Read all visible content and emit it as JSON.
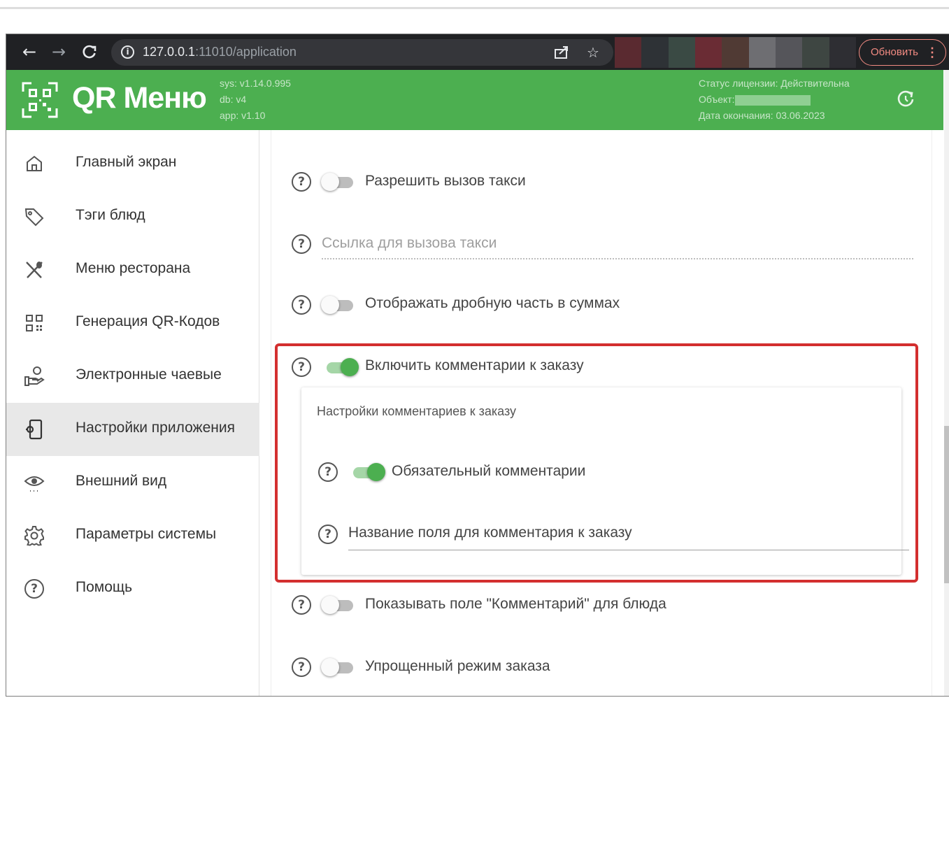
{
  "browser": {
    "url_host": "127.0.0.1",
    "url_rest": ":11010/application",
    "update_label": "Обновить",
    "menu_dots": "⋮"
  },
  "header": {
    "title": "QR Меню",
    "sys_version": "sys: v1.14.0.995",
    "db_version": "db: v4",
    "app_version": "app: v1.10",
    "license_status": "Статус лицензии: Действительна",
    "object_label": "Объект:",
    "expiry": "Дата окончания: 03.06.2023"
  },
  "sidebar": {
    "items": [
      {
        "label": "Главный экран",
        "icon": "home-icon"
      },
      {
        "label": "Тэги блюд",
        "icon": "tag-icon"
      },
      {
        "label": "Меню ресторана",
        "icon": "utensils-icon"
      },
      {
        "label": "Генерация QR-Кодов",
        "icon": "qr-code-icon"
      },
      {
        "label": "Электронные чаевые",
        "icon": "tip-hand-icon"
      },
      {
        "label": "Настройки приложения",
        "icon": "app-settings-icon",
        "active": true
      },
      {
        "label": "Внешний вид",
        "icon": "eye-icon"
      },
      {
        "label": "Параметры системы",
        "icon": "gear-icon"
      },
      {
        "label": "Помощь",
        "icon": "help-icon"
      }
    ]
  },
  "settings": {
    "taxi_toggle": {
      "label": "Разрешить вызов такси",
      "on": false
    },
    "taxi_link": {
      "placeholder": "Ссылка для вызова такси"
    },
    "fraction_toggle": {
      "label": "Отображать дробную часть в суммах",
      "on": false
    },
    "comments_toggle": {
      "label": "Включить комментарии к заказу",
      "on": true
    },
    "comments_section": {
      "title": "Настройки комментариев к заказу",
      "required_toggle": {
        "label": "Обязательный комментарии",
        "on": true
      },
      "field_name": {
        "placeholder": "Название поля для комментария к заказу"
      }
    },
    "dish_comment_toggle": {
      "label": "Показывать поле \"Комментарий\" для блюда",
      "on": false
    },
    "simple_mode_toggle": {
      "label": "Упрощенный режим заказа",
      "on": false
    }
  },
  "help_glyph": "?",
  "colors": {
    "header_green": "#4caf50",
    "switch_on": "#4caf50",
    "highlight_red": "#d32f2f",
    "browser_dark": "#202124"
  }
}
